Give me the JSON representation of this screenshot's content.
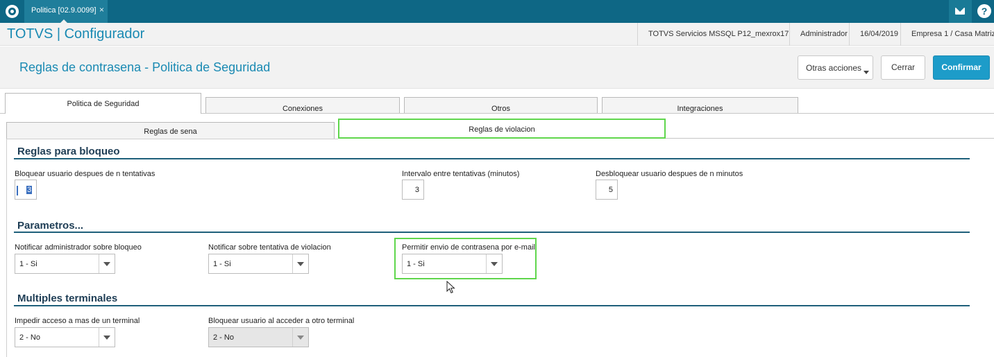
{
  "window_tab": {
    "label": "Politica [02.9.0099]",
    "close": "×"
  },
  "header": {
    "brand": "TOTVS | Configurador",
    "server": "TOTVS Servicios MSSQL P12_mexrox17",
    "user": "Administrador",
    "date": "16/04/2019",
    "company": "Empresa 1 / Casa Matriz"
  },
  "icons": {
    "logo": "totvs-logo-icon",
    "mail": "mail-icon",
    "help": "help-icon",
    "help_glyph": "?"
  },
  "title": "Reglas de contrasena - Politica de Seguridad",
  "actions": {
    "other": "Otras acciones",
    "close": "Cerrar",
    "confirm": "Confirmar"
  },
  "outer_tabs": [
    "Politica de Seguridad",
    "Conexiones",
    "Otros",
    "Integraciones"
  ],
  "inner_tabs": [
    "Reglas de sena",
    "Reglas de violacion"
  ],
  "sections": {
    "bloqueo": {
      "title": "Reglas para bloqueo",
      "fields": [
        {
          "label": "Bloquear usuario despues de n tentativas",
          "value": "3"
        },
        {
          "label": "Intervalo entre tentativas (minutos)",
          "value": "3"
        },
        {
          "label": "Desbloquear usuario despues de n minutos",
          "value": "5"
        }
      ]
    },
    "parametros": {
      "title": "Parametros...",
      "fields": [
        {
          "label": "Notificar administrador sobre bloqueo",
          "value": "1 - Si"
        },
        {
          "label": "Notificar sobre tentativa de violacion",
          "value": "1 - Si"
        },
        {
          "label": "Permitir envio de contrasena por e-mail",
          "value": "1 - Si"
        }
      ]
    },
    "terminales": {
      "title": "Multiples terminales",
      "fields": [
        {
          "label": "Impedir acceso a mas de un terminal",
          "value": "2 - No"
        },
        {
          "label": "Bloquear usuario al acceder a otro terminal",
          "value": "2 - No"
        }
      ]
    }
  },
  "colors": {
    "topbar": "#0e6785",
    "accent": "#1a8ab3",
    "confirm": "#1d9cc9",
    "highlight": "#5fd64c",
    "section_title": "#1e3d55"
  }
}
